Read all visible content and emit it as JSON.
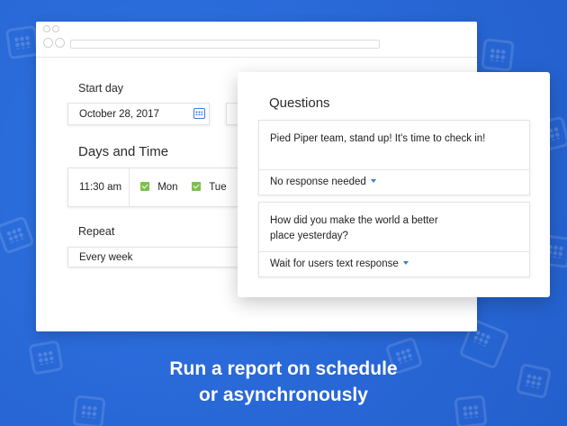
{
  "settings": {
    "start_day_label": "Start day",
    "start_day_value": "October 28, 2017",
    "days_time_title": "Days and Time",
    "time_value": "11:30 am",
    "days": [
      "Mon",
      "Tue"
    ],
    "repeat_label": "Repeat",
    "repeat_value": "Every week"
  },
  "questions": {
    "title": "Questions",
    "items": [
      {
        "text": "Pied Piper team, stand up! It's time to check in!",
        "response": "No response needed"
      },
      {
        "text": "How did you make the world a better place yesterday?",
        "response": "Wait for users text response"
      }
    ]
  },
  "caption": {
    "line1": "Run a report on schedule",
    "line2": "or asynchronously"
  },
  "colors": {
    "background": "#2a6bd9",
    "accent": "#3a7bdc",
    "check": "#7cc04b"
  }
}
